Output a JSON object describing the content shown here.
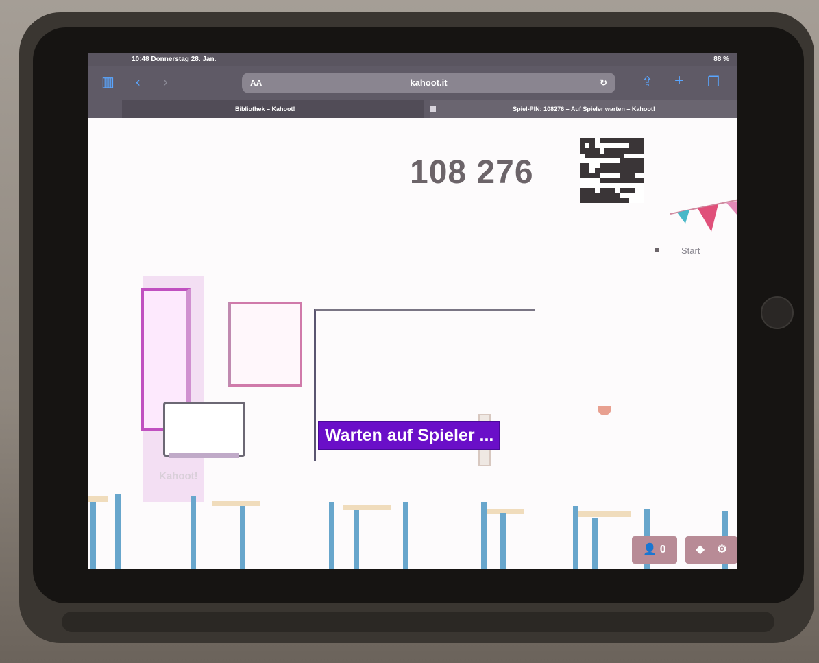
{
  "status_bar": {
    "time": "10:48 Donnerstag 28. Jan.",
    "battery": "88 %"
  },
  "browser": {
    "url_text": "kahoot.it",
    "reader_text": "AA",
    "tabs": [
      {
        "label": "Bibliothek – Kahoot!"
      },
      {
        "label": "Spiel-PIN: 108276 – Auf Spieler warten – Kahoot!"
      }
    ]
  },
  "game": {
    "pin": "108 276",
    "start_label": "Start",
    "waiting_text": "Warten auf Spieler ...",
    "player_count": "0",
    "watermark": "Kahoot!"
  },
  "colors": {
    "accent_purple": "#6a0fc8",
    "browser_blue": "#5aa6ff",
    "control_bg": "#b88b96"
  },
  "icons": {
    "sidebar": "sidebar-icon",
    "back": "chevron-left-icon",
    "forward": "chevron-right-icon",
    "share": "share-icon",
    "new_tab": "plus-icon",
    "tabs_overview": "tabs-icon",
    "player": "user-icon",
    "sound": "speaker-icon",
    "settings": "gear-icon"
  }
}
